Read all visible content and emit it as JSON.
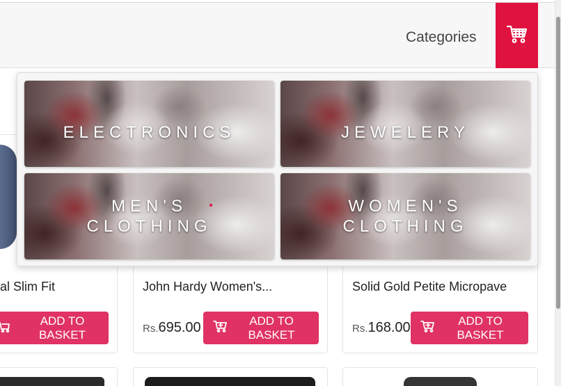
{
  "header": {
    "categories_label": "Categories",
    "cart_icon": "shopping-cart-icon",
    "accent": "#e0123f"
  },
  "categories": [
    {
      "line1": "ELECTRONICS",
      "line2": ""
    },
    {
      "line1": "JEWELERY",
      "line2": ""
    },
    {
      "line1": "MEN'S",
      "line2": "CLOTHING"
    },
    {
      "line1": "WOMEN'S",
      "line2": "CLOTHING"
    }
  ],
  "products": [
    {
      "name": "al Slim Fit",
      "price_currency": "",
      "price_value": "",
      "button_label": "ADD TO BASKET"
    },
    {
      "name": "John Hardy Women's...",
      "price_currency": "Rs.",
      "price_value": "695.00",
      "button_label": "ADD TO BASKET"
    },
    {
      "name": "Solid Gold Petite Micropave",
      "price_currency": "Rs.",
      "price_value": "168.00",
      "button_label": "ADD TO BASKET"
    }
  ],
  "button_color": "#e03264"
}
